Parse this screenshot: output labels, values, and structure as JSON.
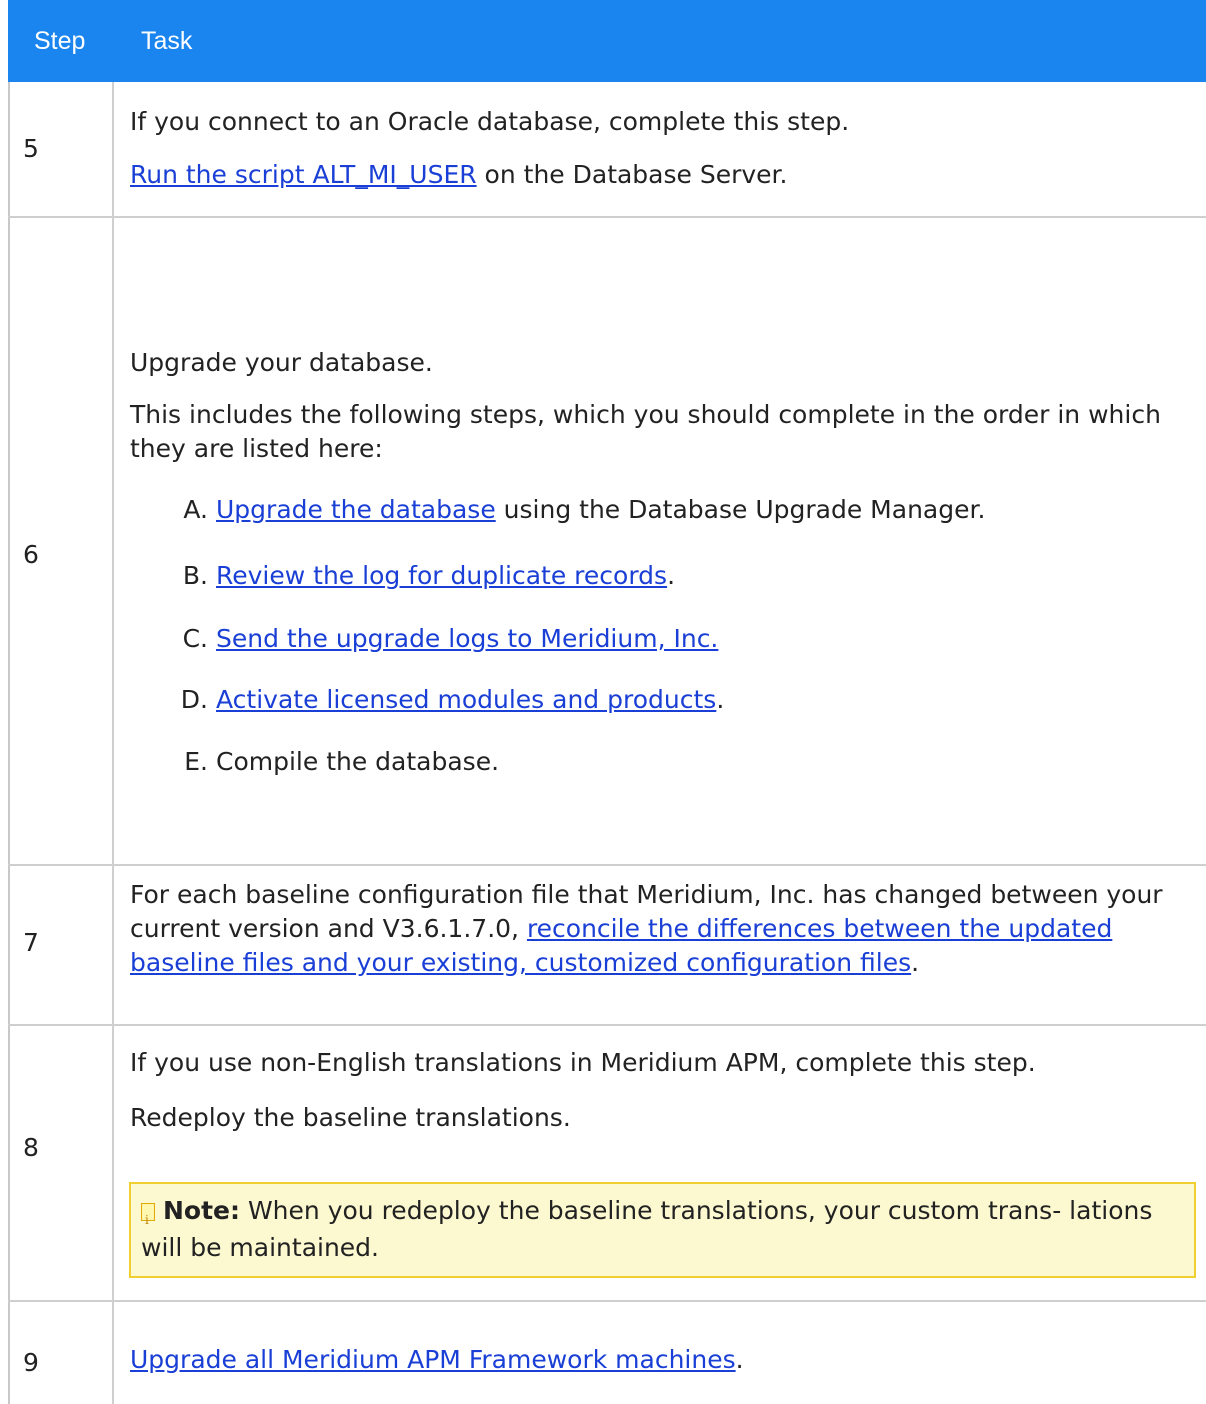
{
  "header": {
    "step_label": "Step",
    "task_label": "Task"
  },
  "rows": [
    {
      "step": "5",
      "line1": "If you connect to an Oracle database, complete this step.",
      "link": "Run the script ALT_MI_USER",
      "after": " on the Database Server."
    },
    {
      "step": "6",
      "intro": "Upgrade your database.",
      "desc": "This includes the following steps, which you should complete in the order in which they are listed here:",
      "items": [
        {
          "letter": "A.",
          "link": "Upgrade the database",
          "after": " using the Database Upgrade Manager."
        },
        {
          "letter": "B.",
          "link": "Review the log for duplicate records",
          "after": "."
        },
        {
          "letter": "C.",
          "link": "Send the upgrade logs to Meridium, Inc.",
          "after": ""
        },
        {
          "letter": "D.",
          "link": "Activate licensed modules and products",
          "after": "."
        },
        {
          "letter": "E.",
          "text": "Compile the database."
        }
      ]
    },
    {
      "step": "7",
      "before": "For each baseline configuration file that Meridium, Inc. has changed between your current version and V3.6.1.7.0, ",
      "link": "reconcile the differences between the updated baseline files and your existing, customized configuration files",
      "after": "."
    },
    {
      "step": "8",
      "line1": "If you use non-English translations in Meridium APM, complete this step.",
      "line2": " Redeploy the baseline translations.",
      "note_label": "Note:",
      "note_text": " When you redeploy the baseline translations, your custom trans- lations will be maintained."
    },
    {
      "step": "9",
      "link": "Upgrade all Meridium APM Framework machines",
      "after": "."
    }
  ],
  "colors": {
    "header_bg": "#1a85ee",
    "link": "#1a3fd6",
    "note_bg": "#fcf8d0",
    "note_border": "#f0d030"
  }
}
